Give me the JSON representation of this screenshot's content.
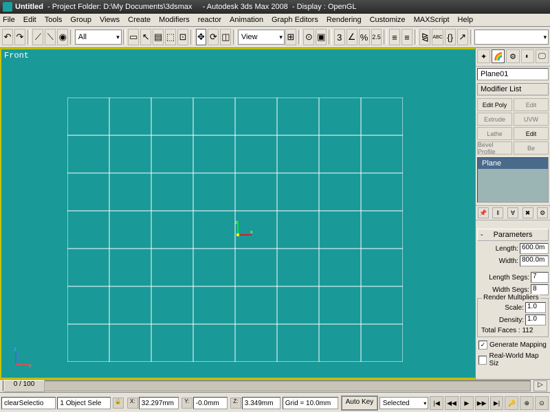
{
  "title": {
    "doc": "Untitled",
    "folder": "- Project Folder: D:\\My Documents\\3dsmax",
    "app": "- Autodesk 3ds Max 2008",
    "display": "- Display : OpenGL"
  },
  "menu": [
    "File",
    "Edit",
    "Tools",
    "Group",
    "Views",
    "Create",
    "Modifiers",
    "reactor",
    "Animation",
    "Graph Editors",
    "Rendering",
    "Customize",
    "MAXScript",
    "Help"
  ],
  "toolbar": {
    "selection_filter": "All",
    "ref_coord": "View",
    "scale_label": "2.5"
  },
  "viewport": {
    "name": "Front",
    "grid_cols": 8,
    "grid_rows": 7
  },
  "panel": {
    "object_name": "Plane01",
    "modifier_list_label": "Modifier List",
    "mod_buttons": [
      {
        "label": "Edit Poly",
        "on": true
      },
      {
        "label": "Edit",
        "on": false
      },
      {
        "label": "Extrude",
        "on": false
      },
      {
        "label": "UVW",
        "on": false
      },
      {
        "label": "Lathe",
        "on": false
      },
      {
        "label": "Edit",
        "on": true
      },
      {
        "label": "Bevel Profile",
        "on": false
      },
      {
        "label": "Be",
        "on": false
      }
    ],
    "stack_item": "Plane",
    "rollout_title": "Parameters",
    "params": {
      "length_lbl": "Length:",
      "length_val": "600.0m",
      "width_lbl": "Width:",
      "width_val": "800.0m",
      "lsegs_lbl": "Length Segs:",
      "lsegs_val": "7",
      "wsegs_lbl": "Width Segs:",
      "wsegs_val": "8",
      "render_mult": "Render Multipliers",
      "scale_lbl": "Scale:",
      "scale_val": "1.0",
      "density_lbl": "Density:",
      "density_val": "1.0",
      "faces": "Total Faces : 112"
    },
    "gen_mapping": "Generate Mapping",
    "real_world": "Real-World Map Siz"
  },
  "timeline": {
    "pos": "0 / 100"
  },
  "status": {
    "script": "clearSelectio",
    "sel": "1 Object Sele",
    "x": "32.297mm",
    "y": "-0.0mm",
    "z": "3.349mm",
    "grid": "Grid = 10.0mm",
    "autokey": "Auto Key",
    "mode": "Selected"
  }
}
